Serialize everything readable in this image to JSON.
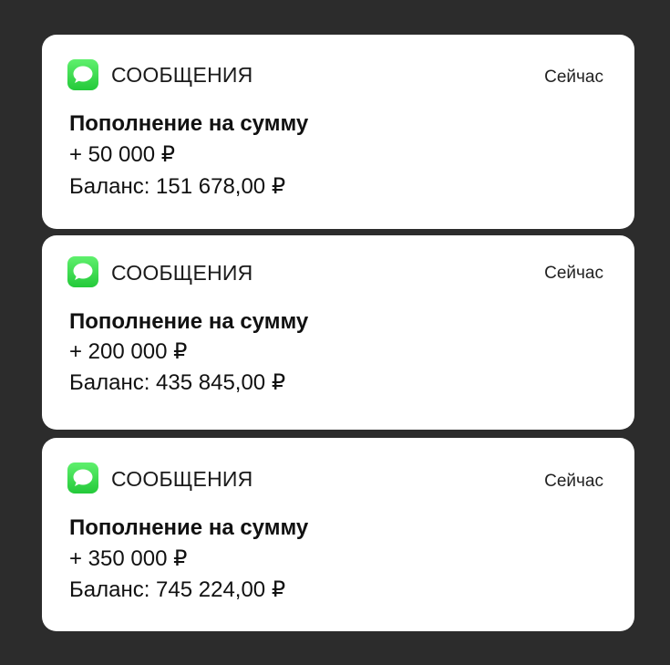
{
  "colors": {
    "background": "#2c2c2c",
    "card": "#ffffff",
    "messages_icon": "#34c749"
  },
  "notifications": [
    {
      "app_icon": "messages-icon",
      "app_name": "СООБЩЕНИЯ",
      "time": "Сейчас",
      "title": "Пополнение на сумму",
      "amount": "+ 50 000 ₽",
      "balance": "Баланс: 151 678,00 ₽"
    },
    {
      "app_icon": "messages-icon",
      "app_name": "СООБЩЕНИЯ",
      "time": "Сейчас",
      "title": "Пополнение на сумму",
      "amount": "+ 200 000 ₽",
      "balance": "Баланс: 435 845,00 ₽"
    },
    {
      "app_icon": "messages-icon",
      "app_name": "СООБЩЕНИЯ",
      "time": "Сейчас",
      "title": "Пополнение на сумму",
      "amount": "+ 350 000 ₽",
      "balance": "Баланс: 745 224,00 ₽"
    }
  ]
}
